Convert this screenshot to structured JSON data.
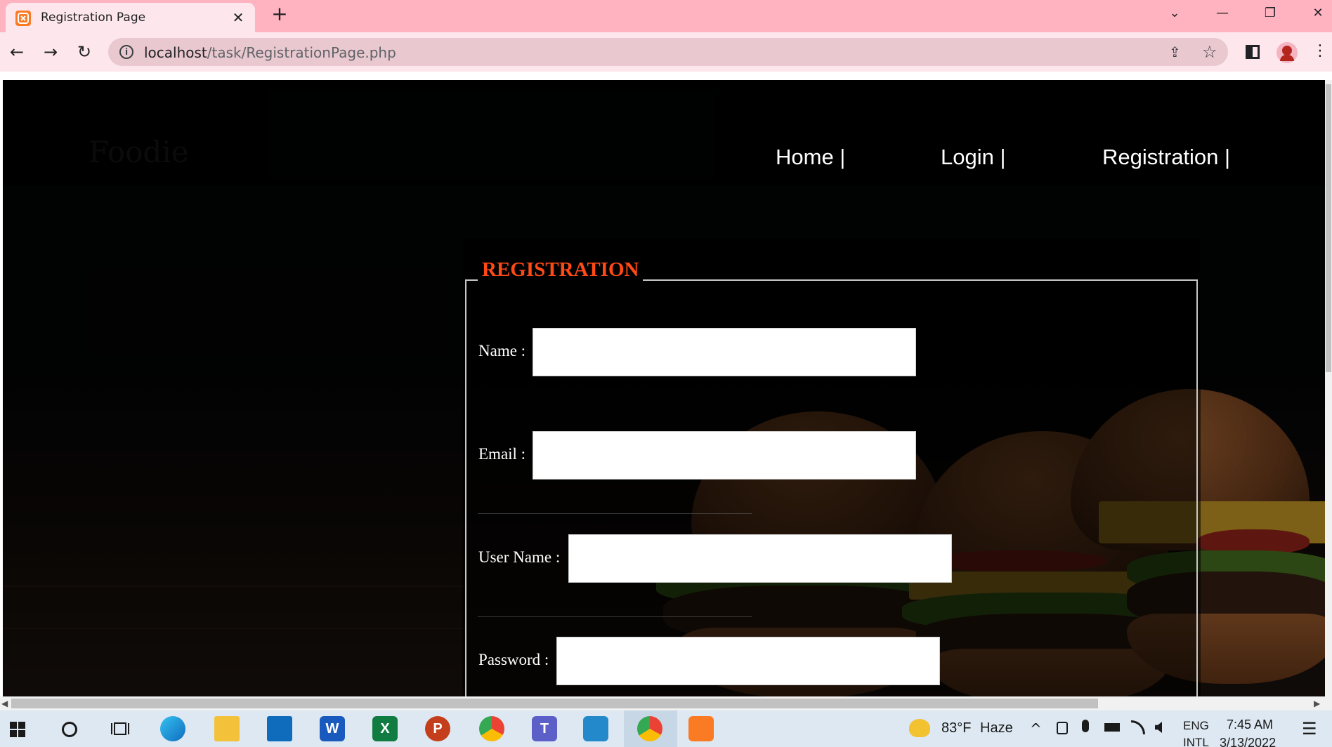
{
  "browser": {
    "tab_title": "Registration Page",
    "url_host": "localhost",
    "url_path": "/task/RegistrationPage.php",
    "close_glyph": "✕",
    "new_tab_glyph": "+",
    "window_controls": {
      "tabs_menu": "⌄",
      "minimize": "—",
      "restore": "❐",
      "close": "✕"
    },
    "nav": {
      "back": "←",
      "forward": "→",
      "reload": "↻"
    },
    "info_glyph": "i",
    "share_glyph": "⇪",
    "star_glyph": "☆",
    "menu_glyph": "⋮"
  },
  "site": {
    "logo": "Foodie",
    "nav_links": [
      "Home |",
      "Login |",
      "Registration |"
    ]
  },
  "form": {
    "legend": "REGISTRATION",
    "fields": [
      {
        "label": "Name :",
        "value": ""
      },
      {
        "label": "Email :",
        "value": ""
      },
      {
        "label": "User Name :",
        "value": ""
      },
      {
        "label": "Password :",
        "value": ""
      }
    ],
    "accent_color": "#ff4a15"
  },
  "scrollbar": {
    "left_arrow": "◀",
    "right_arrow": "▶"
  },
  "taskbar": {
    "weather_temp": "83°F",
    "weather_desc": "Haze",
    "language_line1": "ENG",
    "language_line2": "INTL",
    "time": "7:45 AM",
    "date": "3/13/2022",
    "icons": [
      "windows-start",
      "cortana-search",
      "task-view",
      "edge",
      "file-explorer",
      "mail",
      "word",
      "excel",
      "powerpoint",
      "chrome",
      "teams",
      "vscode",
      "chrome-profile",
      "xampp"
    ],
    "tray_glyphs": {
      "chevron": "^",
      "notification": "☰"
    }
  }
}
